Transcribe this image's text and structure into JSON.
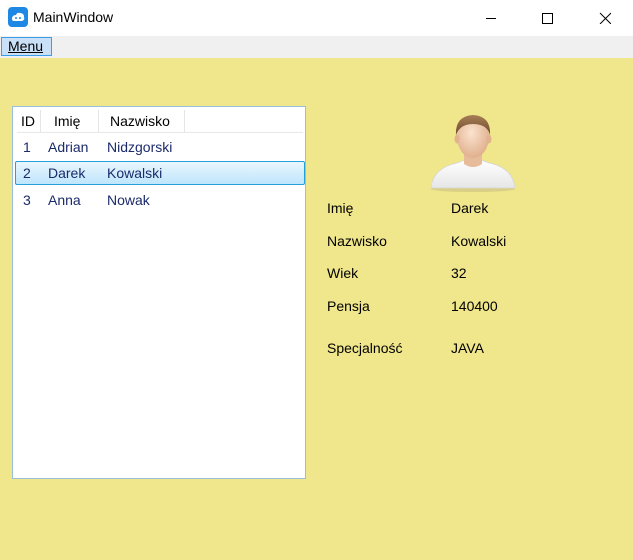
{
  "window": {
    "title": "MainWindow"
  },
  "menu": {
    "label": "Menu"
  },
  "list": {
    "columns": [
      "ID",
      "Imię",
      "Nazwisko"
    ],
    "rows": [
      {
        "id": "1",
        "first": "Adrian",
        "last": "Nidzgorski"
      },
      {
        "id": "2",
        "first": "Darek",
        "last": "Kowalski"
      },
      {
        "id": "3",
        "first": "Anna",
        "last": "Nowak"
      }
    ],
    "selected_index": 1
  },
  "details": {
    "avatar_icon": "user-avatar-icon",
    "fields": [
      {
        "label": "Imię",
        "value": "Darek"
      },
      {
        "label": "Nazwisko",
        "value": "Kowalski"
      },
      {
        "label": "Wiek",
        "value": "32"
      },
      {
        "label": "Pensja",
        "value": "140400"
      },
      {
        "label": "Specjalność",
        "value": "JAVA"
      }
    ]
  },
  "colors": {
    "client_background": "#f0e68c",
    "selection_border": "#26a0da",
    "selection_fill": "#bee6fd",
    "list_text": "#1b2a6b"
  }
}
